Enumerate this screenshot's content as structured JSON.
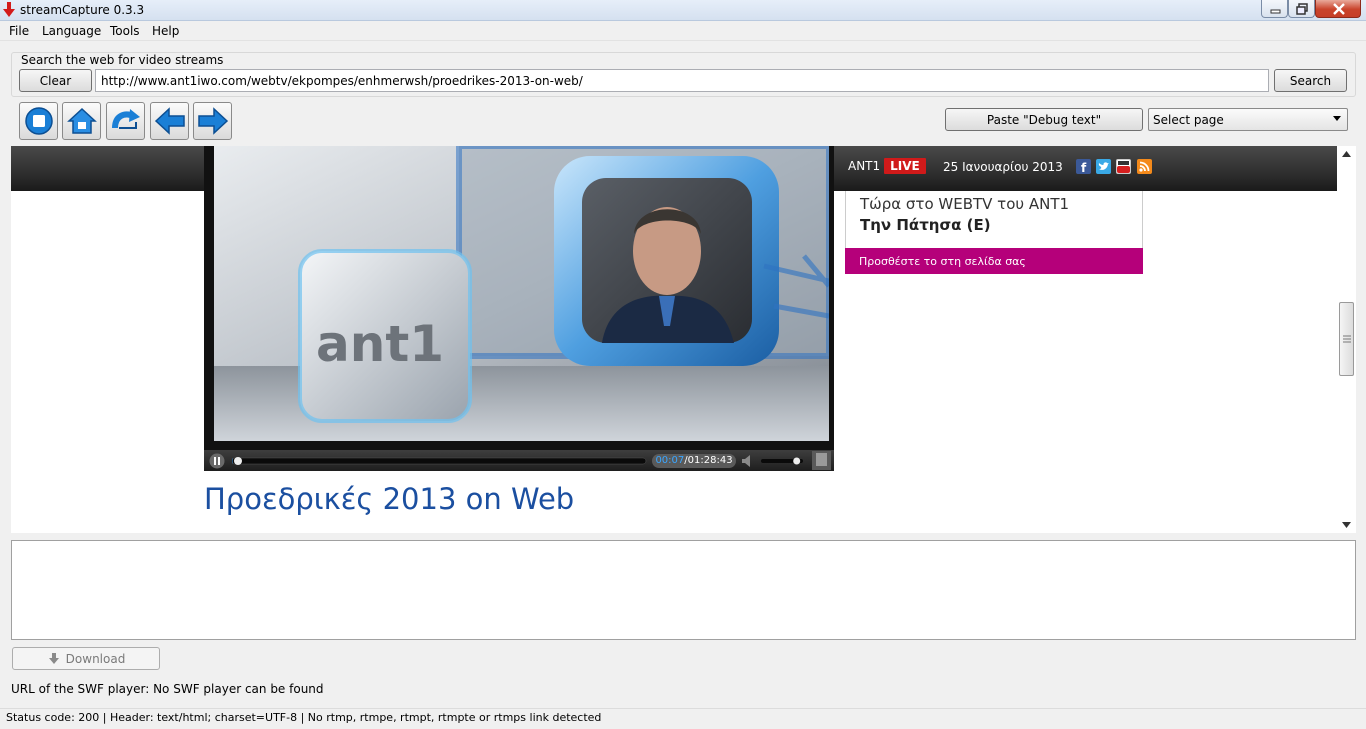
{
  "window": {
    "title": "streamCapture 0.3.3",
    "icons": {
      "app": "download-arrow-icon",
      "minimize": "minimize-icon",
      "maximize": "maximize-icon",
      "close": "close-icon"
    }
  },
  "menu": {
    "items": [
      "File",
      "Language",
      "Tools",
      "Help"
    ]
  },
  "search": {
    "group_label": "Search the web for video streams",
    "clear_label": "Clear",
    "url_value": "http://www.ant1iwo.com/webtv/ekpompes/enhmerwsh/proedrikes-2013-on-web/",
    "search_label": "Search"
  },
  "toolbar": {
    "nav_icons": [
      "stop-icon",
      "home-icon",
      "reload-icon",
      "back-arrow-icon",
      "forward-arrow-icon"
    ],
    "paste_debug_label": "Paste \"Debug text\"",
    "select_page_value": "Select page"
  },
  "webpage": {
    "brand": "ANT1",
    "live_badge": "LIVE",
    "date": "25 Ιανουαρίου 2013",
    "social_icons": [
      "facebook-icon",
      "twitter-icon",
      "youtube-icon",
      "rss-icon"
    ],
    "now_playing_title": "Τώρα στο WEBTV του ANT1",
    "now_playing_show": "Την Πάτησα (Ε)",
    "add_to_page": "Προσθέστε το στη σελίδα σας",
    "video_logo": "ant1",
    "player": {
      "current_time": "00:07",
      "separator": "/",
      "total_time": "01:28:43",
      "progress_fraction": 0.001,
      "volume_fraction": 0.85
    },
    "heading": "Προεδρικές 2013 on Web"
  },
  "bottom": {
    "download_label": "Download",
    "swf_text": "URL of the SWF player: No SWF player can be found",
    "status_text": "Status code: 200 | Header: text/html; charset=UTF-8 | No rtmp, rtmpe, rtmpt, rtmpte or rtmps link detected"
  },
  "colors": {
    "live_red": "#d01a1a",
    "magenta": "#b5007a",
    "heading_blue": "#1b4fa0",
    "player_accent": "#3aa6ff"
  }
}
